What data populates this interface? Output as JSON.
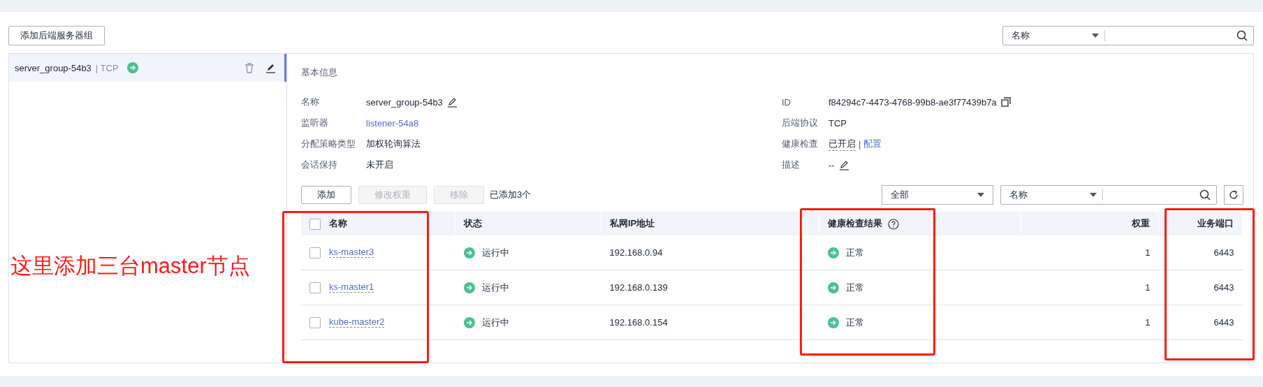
{
  "add_group_button": "添加后端服务器组",
  "search": {
    "field": "名称"
  },
  "groups": [
    {
      "name": "server_group-54b3",
      "protocol": "| TCP",
      "selected": true
    }
  ],
  "basic_info": {
    "title": "基本信息",
    "left": [
      {
        "label": "名称",
        "value": "server_group-54b3",
        "kind": "editable"
      },
      {
        "label": "监听器",
        "value": "listener-54a8",
        "kind": "link"
      },
      {
        "label": "分配策略类型",
        "value": "加权轮询算法",
        "kind": "plain"
      },
      {
        "label": "会话保持",
        "value": "未开启",
        "kind": "plain"
      }
    ],
    "right": [
      {
        "label": "ID",
        "value": "f84294c7-4473-4768-99b8-ae3f77439b7a",
        "kind": "copyable"
      },
      {
        "label": "后端协议",
        "value": "TCP",
        "kind": "plain"
      },
      {
        "label": "健康检查",
        "value": "已开启",
        "separator": "|",
        "link": "配置",
        "kind": "toggle"
      },
      {
        "label": "描述",
        "value": "--",
        "kind": "editable"
      }
    ]
  },
  "toolbar": {
    "buttons": [
      {
        "label": "添加",
        "disabled": false
      },
      {
        "label": "修改权重",
        "disabled": true
      },
      {
        "label": "移除",
        "disabled": true
      }
    ],
    "count": "已添加3个",
    "filter": "全部",
    "search_field": "名称"
  },
  "table": {
    "header_checked": false,
    "columns": [
      "名称",
      "状态",
      "私网IP地址",
      "健康检查结果",
      "权重",
      "业务端口"
    ],
    "rows": [
      {
        "checked": false,
        "name": "ks-master3",
        "status": "运行中",
        "ip": "192.168.0.94",
        "health": "正常",
        "weight": "1",
        "port": "6443"
      },
      {
        "checked": false,
        "name": "ks-master1",
        "status": "运行中",
        "ip": "192.168.0.139",
        "health": "正常",
        "weight": "1",
        "port": "6443"
      },
      {
        "checked": false,
        "name": "kube-master2",
        "status": "运行中",
        "ip": "192.168.0.154",
        "health": "正常",
        "weight": "1",
        "port": "6443"
      }
    ]
  },
  "annotation": "这里添加三台master节点"
}
